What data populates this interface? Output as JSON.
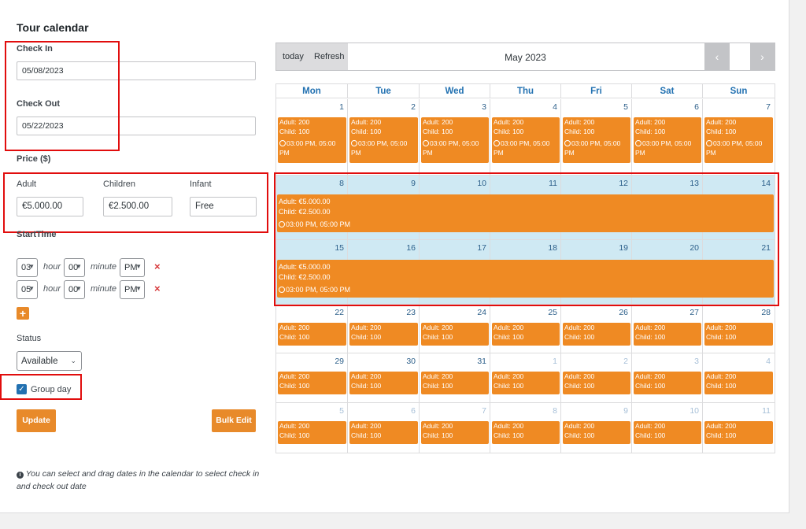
{
  "title": "Tour calendar",
  "check_in": {
    "label": "Check In",
    "value": "05/08/2023"
  },
  "check_out": {
    "label": "Check Out",
    "value": "05/22/2023"
  },
  "price": {
    "label": "Price ($)",
    "adult_label": "Adult",
    "adult_value": "€5.000.00",
    "children_label": "Children",
    "children_value": "€2.500.00",
    "infant_label": "Infant",
    "infant_value": "Free"
  },
  "start_time": {
    "label": "StartTime",
    "hour_word": "hour",
    "minute_word": "minute",
    "rows": [
      {
        "hour": "03",
        "minute": "00",
        "ampm": "PM"
      },
      {
        "hour": "05",
        "minute": "00",
        "ampm": "PM"
      }
    ],
    "remove_icon": "×",
    "add_icon": "+"
  },
  "status": {
    "label": "Status",
    "value": "Available"
  },
  "group_day": {
    "label": "Group day",
    "checked": true
  },
  "buttons": {
    "update": "Update",
    "bulk_edit": "Bulk Edit"
  },
  "note": "You can select and drag dates in the calendar to select check in and check out date",
  "calendar": {
    "today": "today",
    "refresh": "Refresh",
    "month": "May 2023",
    "prev_icon": "‹",
    "next_icon": "›",
    "days": [
      "Mon",
      "Tue",
      "Wed",
      "Thu",
      "Fri",
      "Sat",
      "Sun"
    ],
    "week1": [
      "1",
      "2",
      "3",
      "4",
      "5",
      "6",
      "7"
    ],
    "week2": [
      "8",
      "9",
      "10",
      "11",
      "12",
      "13",
      "14"
    ],
    "week3": [
      "15",
      "16",
      "17",
      "18",
      "19",
      "20",
      "21"
    ],
    "week4": [
      "22",
      "23",
      "24",
      "25",
      "26",
      "27",
      "28"
    ],
    "week5": [
      "29",
      "30",
      "31",
      "1",
      "2",
      "3",
      "4"
    ],
    "week6": [
      "5",
      "6",
      "7",
      "8",
      "9",
      "10",
      "11"
    ],
    "event_adult": "Adult: 200",
    "event_child": "Child: 100",
    "event_time": "03:00 PM, 05:00 PM",
    "group_adult": "Adult: €5.000.00",
    "group_child": "Child: €2.500.00",
    "group_time": "03:00 PM, 05:00 PM"
  },
  "colors": {
    "accent": "#ef8a23",
    "highlight_week": "#cfe9f3",
    "annotation_red": "#e10d0d",
    "day_header": "#2271b1"
  }
}
